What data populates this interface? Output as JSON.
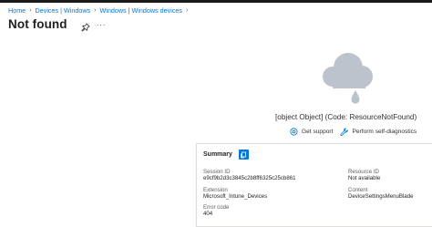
{
  "breadcrumb": {
    "items": [
      "Home",
      "Devices | Windows",
      "Windows | Windows devices"
    ]
  },
  "header": {
    "title": "Not found",
    "more": "···"
  },
  "error": {
    "message": "[object Object] (Code: ResourceNotFound)"
  },
  "actions": {
    "support_label": "Get support",
    "diagnostics_label": "Perform self-diagnostics"
  },
  "summary": {
    "title": "Summary",
    "fields": {
      "session_id": {
        "label": "Session ID",
        "value": "e9cf9b2d3c3845c2b8ff6325c25cb861"
      },
      "resource_id": {
        "label": "Resource ID",
        "value": "Not available"
      },
      "extension": {
        "label": "Extension",
        "value": "Microsoft_Intune_Devices"
      },
      "content": {
        "label": "Content",
        "value": "DeviceSettingsMenuBlade"
      },
      "error_code": {
        "label": "Error code",
        "value": "404"
      }
    }
  },
  "colors": {
    "accent": "#0078d4",
    "cloud": "#bcc3cc",
    "text": "#323130"
  },
  "icons": [
    "chevron-right-icon",
    "pin-icon",
    "more-icon",
    "cloud-icon",
    "support-icon",
    "wrench-icon",
    "copy-icon"
  ]
}
